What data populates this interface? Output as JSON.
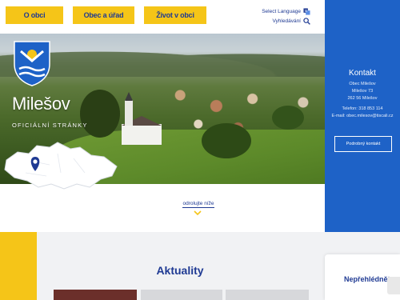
{
  "nav": {
    "items": [
      {
        "label": "O obci"
      },
      {
        "label": "Obec a úřad"
      },
      {
        "label": "Život v obci"
      }
    ]
  },
  "utility": {
    "language_label": "Select Language",
    "search_label": "Vyhledávání",
    "language_icon": "translate-icon",
    "search_icon": "search-icon"
  },
  "hero": {
    "town_name": "Milešov",
    "subtitle": "OFICIÁLNÍ STRÁNKY",
    "crest_icon": "coat-of-arms-icon",
    "map_icon": "czech-map-location-icon"
  },
  "scroll_hint": {
    "label": "odrolujte níže"
  },
  "contact": {
    "title": "Kontakt",
    "lines": [
      "Obec Milešov",
      "Milešov 73",
      "262 56 Milešov",
      "Telefon: 318 853 114",
      "E-mail: obec.milesov@tiscali.cz"
    ],
    "button_label": "Podrobný kontakt"
  },
  "news": {
    "title": "Aktuality"
  },
  "sidebar_card": {
    "title": "Nepřehlédněte"
  },
  "colors": {
    "primary_blue": "#1e62c7",
    "accent_yellow": "#f5c518",
    "text_blue": "#1f3a93"
  }
}
